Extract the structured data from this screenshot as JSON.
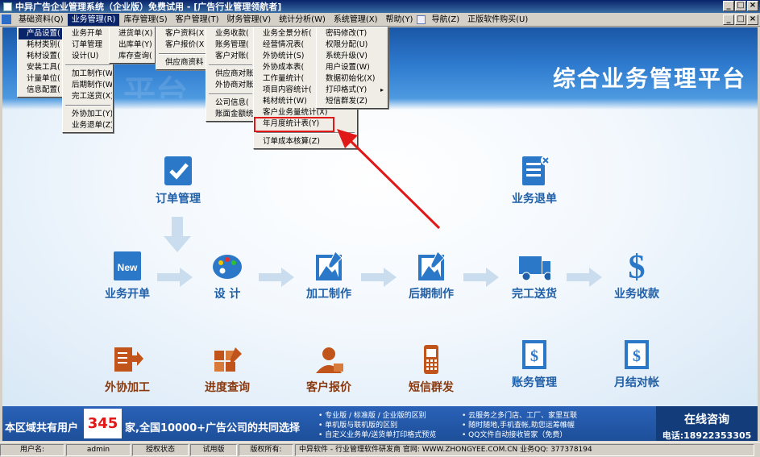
{
  "window": {
    "title": "中异广告企业管理系统（企业版）免费试用 - [广告行业管理领航者]"
  },
  "menubar": {
    "items": [
      "基础资料(Q)",
      "业务管理(R)",
      "库存管理(S)",
      "客户管理(T)",
      "财务管理(V)",
      "统计分析(W)",
      "系统管理(X)",
      "帮助(Y)",
      "导航(Z)",
      "正版软件购买(U)"
    ]
  },
  "menus": {
    "basic": [
      "产品设置(",
      "耗材类别(",
      "耗材设置(",
      "安装工具(",
      "计量单位(",
      "信息配置("
    ],
    "business": [
      "业务开单",
      "订单管理",
      "设计(U)",
      "加工制作(W)",
      "后期制作(W)",
      "完工送货(X)",
      "外协加工(Y)",
      "业务退单(Z)"
    ],
    "inventory": [
      "进货单(X)",
      "出库单(Y)",
      "库存查询("
    ],
    "customer": [
      "客户资料(X",
      "客户报价(X",
      "供应商资料"
    ],
    "finance": [
      "业务收款(",
      "账务管理(",
      "客户对账(",
      "供应商对账",
      "外协商对账",
      "公司信息(",
      "账面金额统"
    ],
    "stats": [
      "业务全景分析(",
      "经营情况表(",
      "外协统计(S)",
      "外协成本表(",
      "工作量统计(",
      "项目内容统计(",
      "耗材统计(W)",
      "客户业务量统计(X)",
      "年月度统计表(Y)",
      "订单成本核算(Z)"
    ],
    "system": [
      "密码修改(T)",
      "权限分配(U)",
      "系统升级(V)",
      "用户设置(W)",
      "数据初始化(X)",
      "打印格式(Y)",
      "短信群发(Z)"
    ]
  },
  "main": {
    "platform_title": "综合业务管理平台",
    "banner_ghost": "平台",
    "nodes": {
      "order_manage": "订单管理",
      "business_return": "业务退单",
      "open_order": "业务开单",
      "design": "设 计",
      "processing": "加工制作",
      "post_production": "后期制作",
      "delivery": "完工送货",
      "collection": "业务收款",
      "outsource": "外协加工",
      "progress": "进度查询",
      "quote": "客户报价",
      "sms": "短信群发",
      "accounts": "账务管理",
      "monthly": "月结对帐"
    }
  },
  "infobar": {
    "prefix": "本区域共有用户",
    "count": "345",
    "suffix": "家,全国10000+广告公司的共同选择",
    "bullets": [
      "专业版 / 标准版 / 企业版的区别",
      "单机版与联机版的区别",
      "自定义业务单/送货单打印格式预览",
      "云服务之多门店、工厂、家里互联",
      "随时随地,手机查帐,助您运筹帷幄",
      "QQ文件自动接收管家（免费）"
    ],
    "consult_title": "在线咨询",
    "consult_phone": "电话:18922353305"
  },
  "statusbar": {
    "user_label": "用户名:",
    "user": "admin",
    "auth_label": "授权状态",
    "auth": "试用版",
    "copyright_label": "版权所有:",
    "copyright": "中异软件 - 行业管理软件研发商 官网: WWW.ZHONGYEE.COM.CN 业务QQ: 377378194"
  }
}
